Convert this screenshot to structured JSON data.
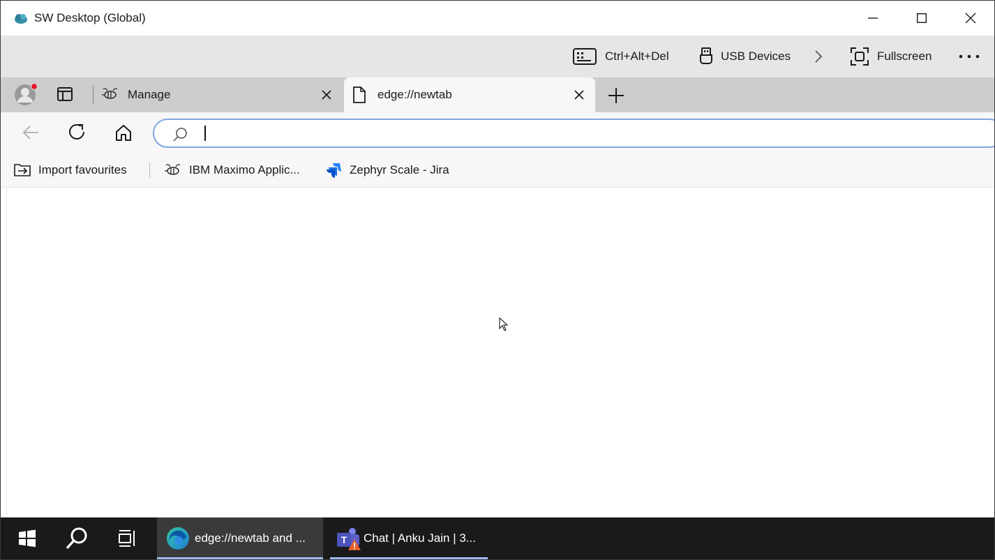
{
  "window": {
    "title": "SW Desktop (Global)"
  },
  "remote_toolbar": {
    "ctrl_alt_del": "Ctrl+Alt+Del",
    "usb_devices": "USB Devices",
    "fullscreen": "Fullscreen"
  },
  "tabs": [
    {
      "label": "Manage",
      "icon": "maximo-bee-icon",
      "active": false
    },
    {
      "label": "edge://newtab",
      "icon": "page-icon",
      "active": true
    }
  ],
  "address_bar": {
    "value": "",
    "placeholder": ""
  },
  "favourites": [
    {
      "label": "Import favourites",
      "icon": "import-icon"
    },
    {
      "label": "IBM Maximo Applic...",
      "icon": "maximo-bee-icon"
    },
    {
      "label": "Zephyr Scale - Jira",
      "icon": "jira-icon"
    }
  ],
  "taskbar": {
    "apps": [
      {
        "label": "edge://newtab and ...",
        "icon": "edge-icon",
        "active": true
      },
      {
        "label": "Chat | Anku Jain | 3...",
        "icon": "teams-icon",
        "active": false
      }
    ]
  },
  "colors": {
    "omnibox_border": "#7fa7df",
    "taskbar_bg": "#1a1a1a",
    "taskbar_active_underline": "#9bbcf0",
    "notification_dot": "#e81123"
  }
}
